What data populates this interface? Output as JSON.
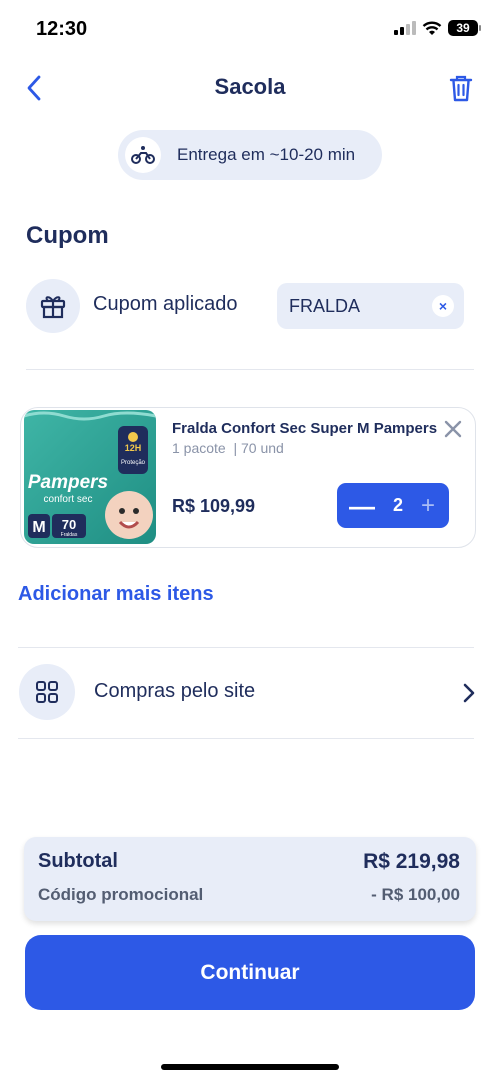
{
  "status_bar": {
    "time": "12:30",
    "battery": "39"
  },
  "header": {
    "title": "Sacola"
  },
  "delivery": {
    "text": "Entrega em ~10-20 min"
  },
  "coupon": {
    "section_title": "Cupom",
    "label": "Cupom aplicado",
    "code": "FRALDA",
    "clear_icon": "×"
  },
  "product": {
    "name": "Fralda Confort Sec Super M Pampers",
    "package": "1 pacote  | 70 und",
    "price": "R$ 109,99",
    "quantity": "2",
    "image": {
      "brand": "Pampers",
      "line": "confort sec",
      "size": "M",
      "count": "70",
      "count_label": "Fraldas",
      "badge": "12H",
      "badge_sub": "Proteção"
    }
  },
  "add_more": "Adicionar mais itens",
  "site_purchases": {
    "label": "Compras pelo site"
  },
  "summary": {
    "subtotal_label": "Subtotal",
    "subtotal_value": "R$ 219,98",
    "promo_label": "Código promocional",
    "promo_value": "- R$ 100,00"
  },
  "continue_button": "Continuar",
  "colors": {
    "primary": "#2d59e6",
    "navy": "#1f2d5c",
    "light_bg": "#e8edf8"
  }
}
